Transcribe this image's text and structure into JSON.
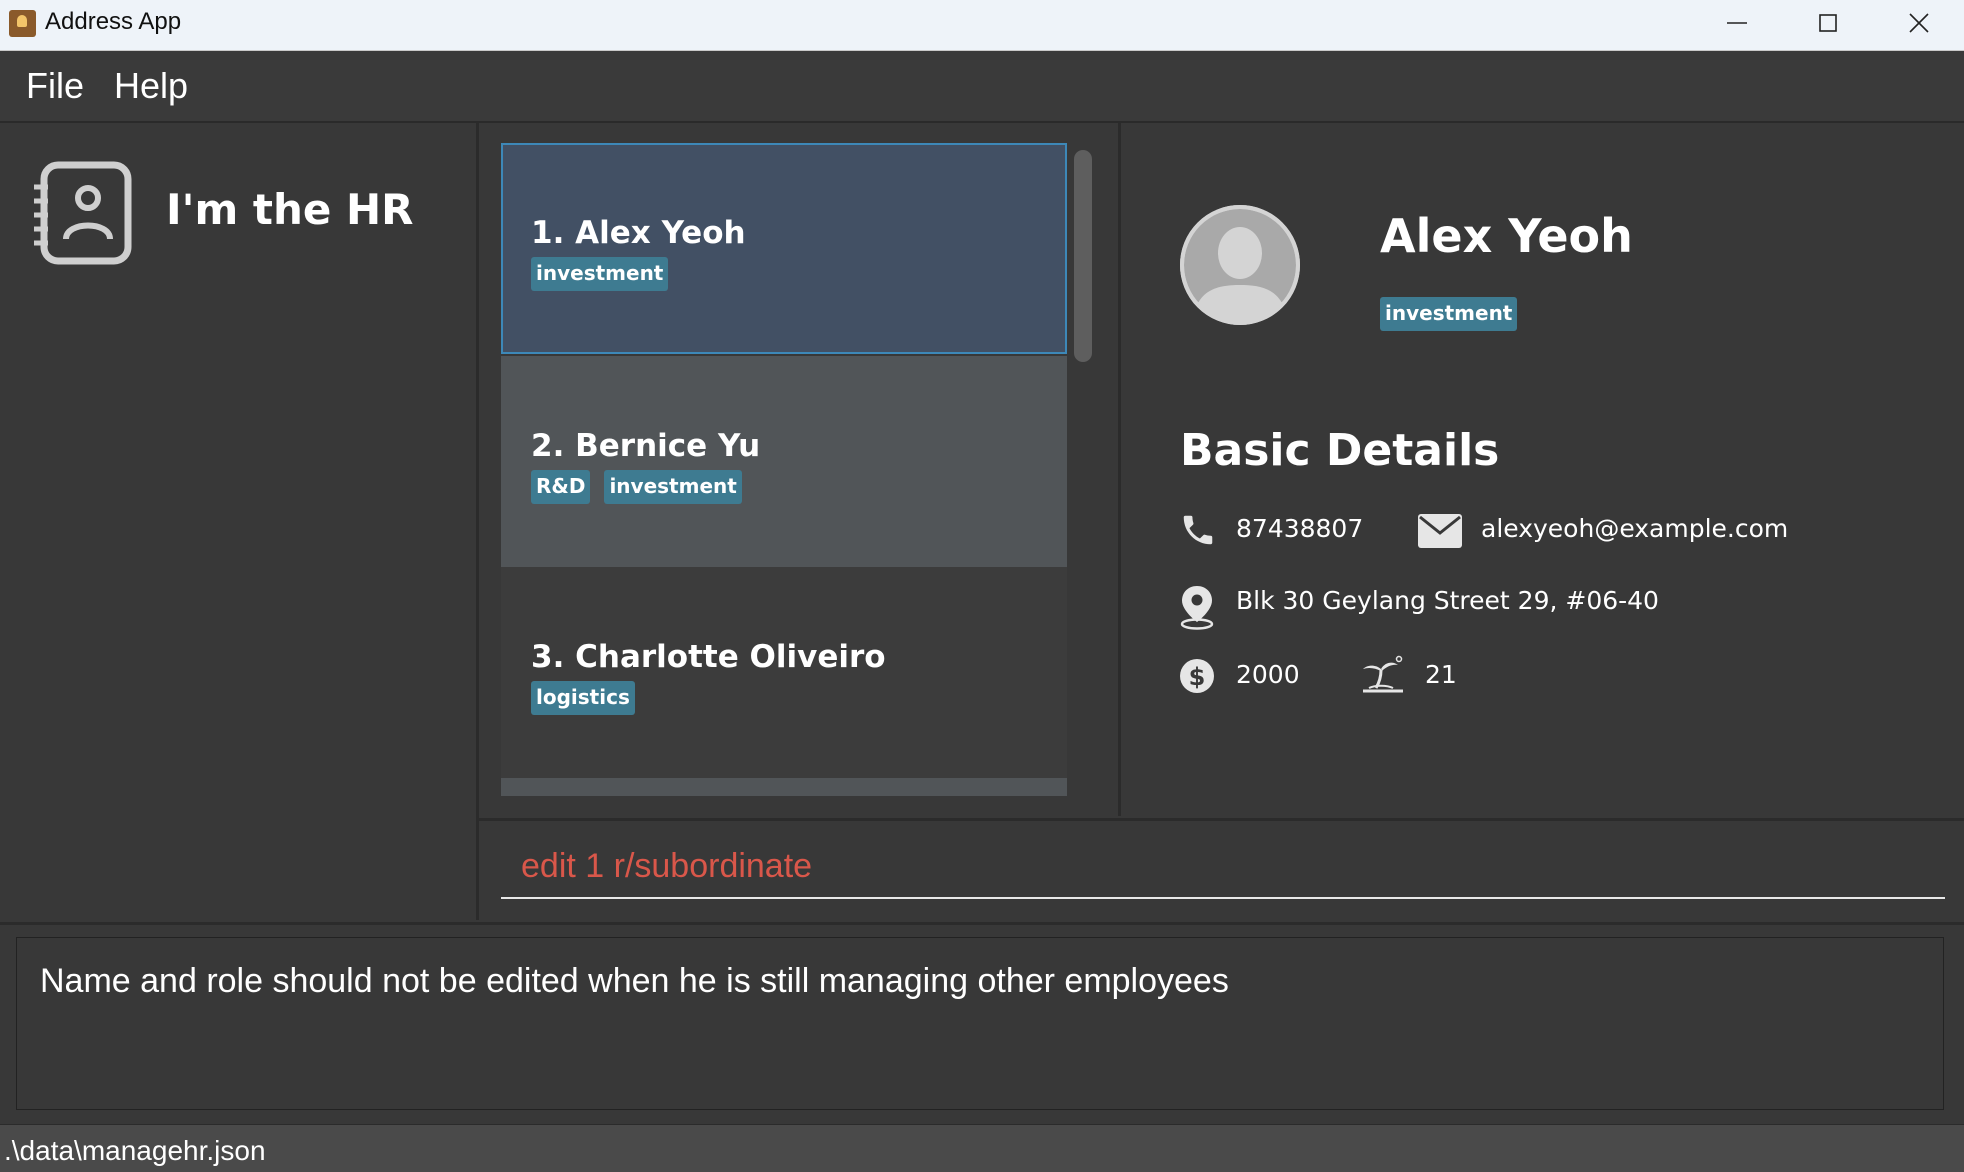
{
  "window": {
    "title": "Address App",
    "minimize_icon": "minimize-icon",
    "maximize_icon": "maximize-icon",
    "close_icon": "close-icon"
  },
  "menu": {
    "items": [
      {
        "label": "File"
      },
      {
        "label": "Help"
      }
    ]
  },
  "sidebar": {
    "logo_icon": "address-book-icon",
    "title": "I'm the HR"
  },
  "person_list": {
    "items": [
      {
        "index": "1.",
        "name": "Alex Yeoh",
        "display": "1.  Alex Yeoh",
        "tags": [
          "investment"
        ],
        "selected": true
      },
      {
        "index": "2.",
        "name": "Bernice Yu",
        "display": "2.  Bernice Yu",
        "tags": [
          "R&D",
          "investment"
        ],
        "selected": false
      },
      {
        "index": "3.",
        "name": "Charlotte Oliveiro",
        "display": "3.  Charlotte Oliveiro",
        "tags": [
          "logistics"
        ],
        "selected": false
      }
    ]
  },
  "detail": {
    "name": "Alex Yeoh",
    "tag": "investment",
    "section_title": "Basic Details",
    "phone": "87438807",
    "email": "alexyeoh@example.com",
    "address": "Blk 30 Geylang Street 29, #06-40",
    "salary": "2000",
    "leave": "21",
    "icons": {
      "avatar": "user-avatar-icon",
      "phone": "phone-icon",
      "email": "mail-icon",
      "address": "location-pin-icon",
      "salary": "dollar-icon",
      "leave": "beach-icon"
    }
  },
  "command": {
    "value": "edit 1 r/subordinate"
  },
  "result": {
    "message": "Name and role should not be edited when he is still managing other employees"
  },
  "status": {
    "path": ".\\data\\managehr.json"
  },
  "colors": {
    "background": "#383838",
    "tag": "#3e7b91",
    "selected_card": "#425064",
    "selected_border": "#3d88b8",
    "command_text": "#d9574a"
  }
}
